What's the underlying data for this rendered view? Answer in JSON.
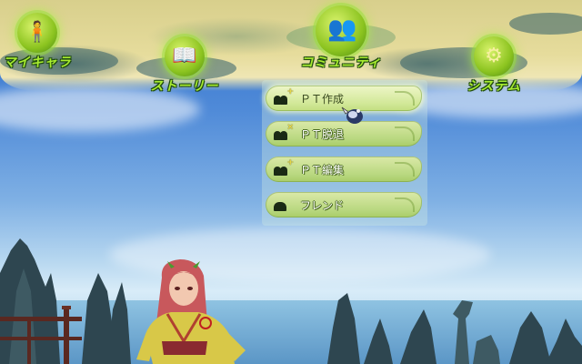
{
  "top_menu": [
    {
      "label": "マイキャラ",
      "icon": "mychara-icon",
      "glyph": "🧍"
    },
    {
      "label": "ストーリー",
      "icon": "story-book-icon",
      "glyph": "📖"
    },
    {
      "label": "コミュニティ",
      "icon": "community-icon",
      "glyph": "👥"
    },
    {
      "label": "システム",
      "icon": "system-gear-icon",
      "glyph": "⚙"
    }
  ],
  "community_submenu": [
    {
      "label": "ＰＴ作成",
      "icon": "party-create-icon",
      "mark": "+"
    },
    {
      "label": "ＰＴ脱退",
      "icon": "party-leave-icon",
      "mark": "×"
    },
    {
      "label": "ＰＴ編集",
      "icon": "party-edit-icon",
      "mark": "+"
    },
    {
      "label": "フレンド",
      "icon": "friend-icon",
      "mark": ""
    }
  ],
  "colors": {
    "menu_label": "#a8ec30",
    "menu_circle": "#8cc420",
    "submenu_fill": "#b9d880"
  }
}
